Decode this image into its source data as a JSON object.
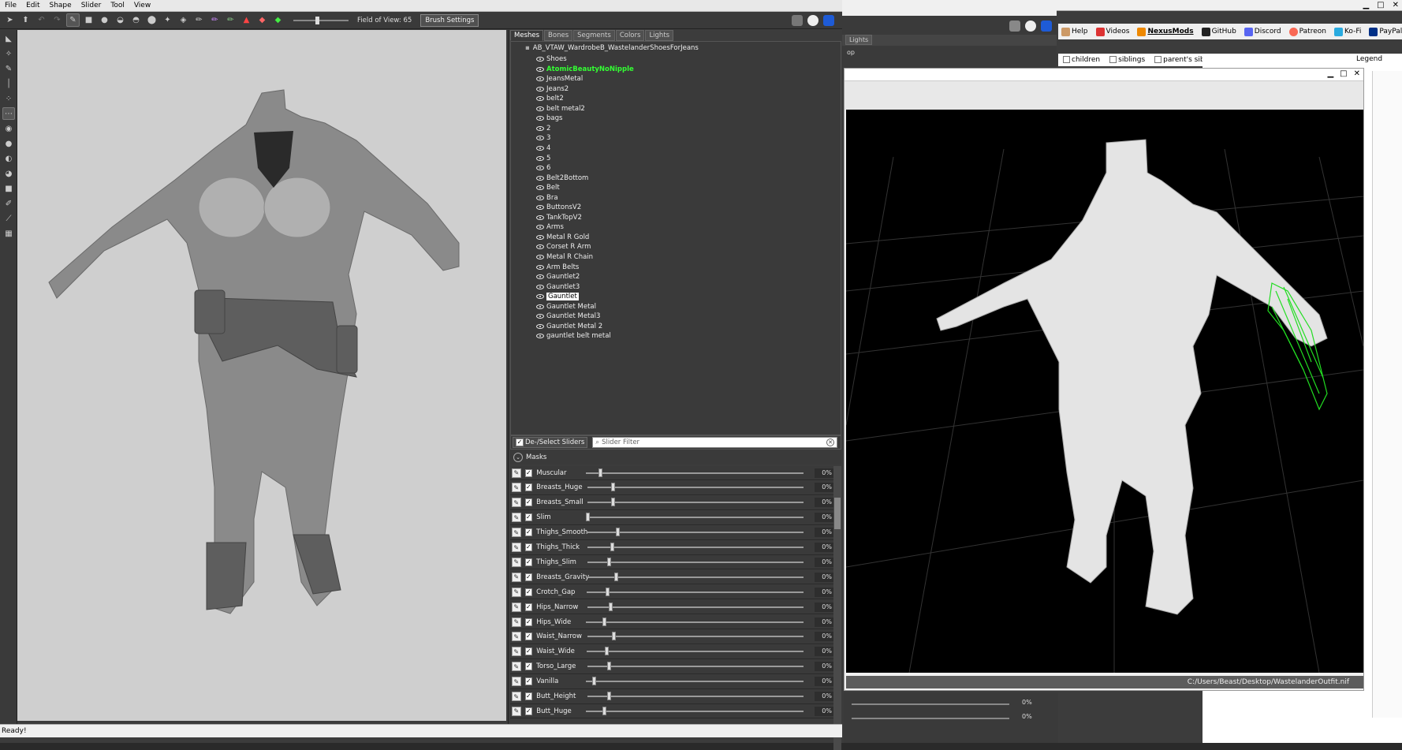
{
  "menu": [
    "File",
    "Edit",
    "Shape",
    "Slider",
    "Tool",
    "View"
  ],
  "toolbar": {
    "fov_label": "Field of View: 65",
    "brush_settings": "Brush Settings"
  },
  "tabs": [
    "Meshes",
    "Bones",
    "Segments",
    "Colors",
    "Lights"
  ],
  "tree": {
    "root": "AB_VTAW_WardrobeB_WastelanderShoesForJeans",
    "items": [
      "Shoes",
      "AtomicBeautyNoNipple",
      "JeansMetal",
      "Jeans2",
      "belt2",
      "belt metal2",
      "bags",
      "2",
      "3",
      "4",
      "5",
      "6",
      "Belt2Bottom",
      "Belt",
      "Bra",
      "ButtonsV2",
      "TankTopV2",
      "Arms",
      "Metal R Gold",
      "Corset R Arm",
      "Metal R Chain",
      "Arm Belts",
      "Gauntlet2",
      "Gauntlet3",
      "Gauntlet",
      "Gauntlet Metal",
      "Gauntlet Metal3",
      "Gauntlet Metal 2",
      "gauntlet belt metal"
    ],
    "highlighted": "AtomicBeautyNoNipple",
    "selected": "Gauntlet"
  },
  "slider_panel": {
    "deselect_label": "De-/Select Sliders",
    "filter_placeholder": "Slider Filter",
    "masks_label": "Masks"
  },
  "sliders": [
    {
      "name": "Muscular",
      "value": "0%",
      "pos": 0.0
    },
    {
      "name": "Breasts_Huge",
      "value": "0%",
      "pos": 0.055
    },
    {
      "name": "Breasts_Small",
      "value": "0%",
      "pos": 0.055
    },
    {
      "name": "Slim",
      "value": "0%",
      "pos": -0.06
    },
    {
      "name": "Thighs_Smooth",
      "value": "0%",
      "pos": 0.08
    },
    {
      "name": "Thighs_Thick",
      "value": "0%",
      "pos": 0.05
    },
    {
      "name": "Thighs_Slim",
      "value": "0%",
      "pos": 0.035
    },
    {
      "name": "Breasts_Gravity",
      "value": "0%",
      "pos": 0.07
    },
    {
      "name": "Crotch_Gap",
      "value": "0%",
      "pos": 0.03
    },
    {
      "name": "Hips_Narrow",
      "value": "0%",
      "pos": 0.045
    },
    {
      "name": "Hips_Wide",
      "value": "0%",
      "pos": 0.02
    },
    {
      "name": "Waist_Narrow",
      "value": "0%",
      "pos": 0.06
    },
    {
      "name": "Waist_Wide",
      "value": "0%",
      "pos": 0.03
    },
    {
      "name": "Torso_Large",
      "value": "0%",
      "pos": 0.035
    },
    {
      "name": "Vanilla",
      "value": "0%",
      "pos": -0.03
    },
    {
      "name": "Butt_Height",
      "value": "0%",
      "pos": 0.035
    },
    {
      "name": "Butt_Huge",
      "value": "0%",
      "pos": 0.02
    }
  ],
  "status": "Ready!",
  "browser_bar": [
    "Help",
    "Videos",
    "NexusMods",
    "GitHub",
    "Discord",
    "Patreon",
    "Ko-Fi",
    "PayPal"
  ],
  "browser_options": [
    "children",
    "siblings",
    "parent's siblings"
  ],
  "legend_label": "Legend",
  "viewer": {
    "path": "C:/Users/Beast/Desktop/WastelanderOutfit.nif"
  },
  "second_app": {
    "tab": "Lights",
    "text": "op"
  },
  "bottom_pcts": [
    "0%",
    "0%"
  ],
  "colors": {
    "accent": "#33ff33",
    "panel": "#3a3a3a"
  }
}
